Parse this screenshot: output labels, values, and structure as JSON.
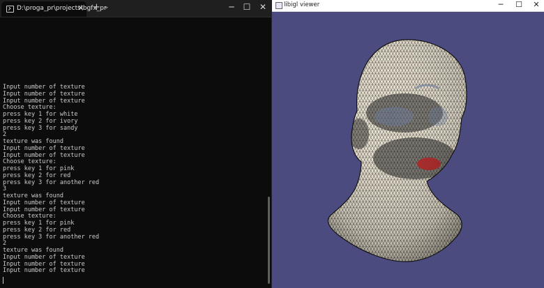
{
  "terminal": {
    "tab_title": "D:\\proga_pr\\projects\\bgfx_pr",
    "tab_close": "✕",
    "new_tab": "+",
    "dropdown": "⌄",
    "minimize": "─",
    "maximize": "☐",
    "close": "✕",
    "lines": [
      "Input number of texture",
      "Input number of texture",
      "Input number of texture",
      "Choose texture:",
      "press key 1 for white",
      "press key 2 for ivory",
      "press key 3 for sandy",
      "2",
      "texture was found",
      "Input number of texture",
      "Input number of texture",
      "Choose texture:",
      "press key 1 for pink",
      "press key 2 for red",
      "press key 3 for another red",
      "3",
      "texture was found",
      "Input number of texture",
      "Input number of texture",
      "Choose texture:",
      "press key 1 for pink",
      "press key 2 for red",
      "press key 3 for another red",
      "2",
      "texture was found",
      "Input number of texture",
      "Input number of texture",
      "Input number of texture"
    ]
  },
  "viewer": {
    "title": "libigl viewer",
    "minimize": "─",
    "maximize": "☐",
    "close": "✕",
    "background_color": "#4b4b80",
    "mesh_color": "#ece4d2",
    "lip_color": "#b02020"
  }
}
